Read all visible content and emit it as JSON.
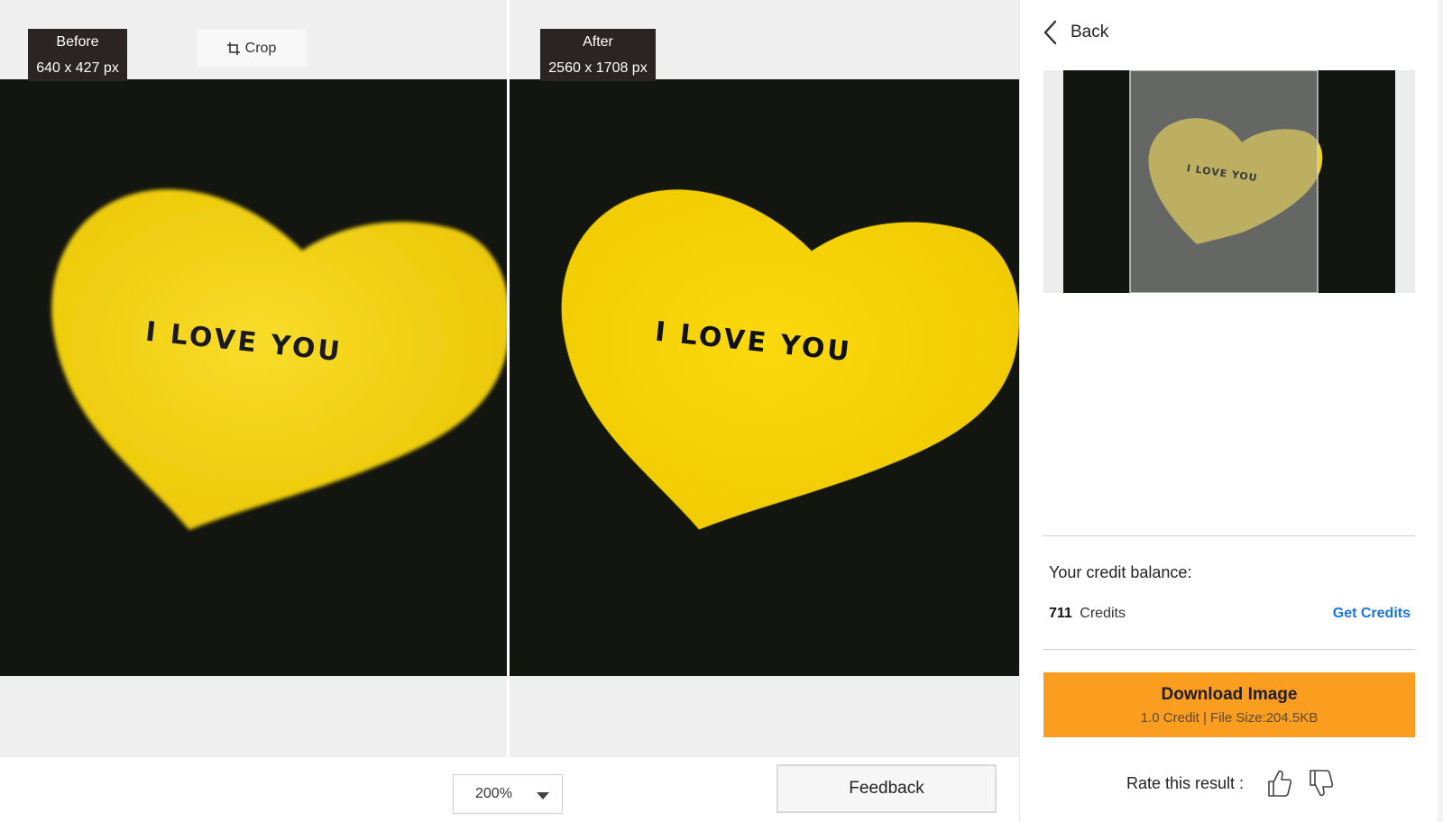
{
  "compare": {
    "before": {
      "label": "Before",
      "dimensions": "640 x 427 px"
    },
    "after": {
      "label": "After",
      "dimensions": "2560 x 1708 px"
    },
    "crop_label": "Crop",
    "image_text": "I LOVE YOU"
  },
  "bottom_bar": {
    "zoom_value": "200%",
    "feedback_label": "Feedback"
  },
  "panel": {
    "back_label": "Back",
    "credit_title": "Your credit balance:",
    "credit_count": "711",
    "credit_unit": "Credits",
    "get_credits_label": "Get Credits",
    "download_label": "Download Image",
    "download_meta": "1.0 Credit | File Size:204.5KB",
    "rate_label": "Rate this result :"
  },
  "icons": {
    "crop": "crop-icon",
    "back": "chevron-left-icon",
    "zoom_dropdown": "caret-down-icon",
    "like": "thumbs-up-icon",
    "dislike": "thumbs-down-icon"
  },
  "colors": {
    "accent": "#fb9e1f",
    "link": "#1a73e8",
    "heart": "#f5d10a",
    "photo_bg": "#121510",
    "tag_bg": "#2a2522"
  }
}
